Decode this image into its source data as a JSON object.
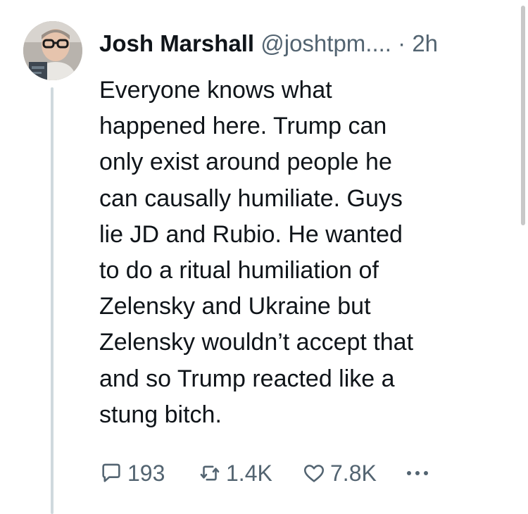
{
  "tweet": {
    "author": {
      "name": "Josh Marshall",
      "handle": "@joshtpm....",
      "separator": "·",
      "time": "2h"
    },
    "text_lines": [
      "Everyone knows what",
      "happened here. Trump can",
      "only exist around people he",
      "can causally humiliate. Guys",
      "lie JD and Rubio. He wanted",
      "to do a ritual humiliation of",
      "Zelensky and Ukraine but",
      "Zelensky wouldn’t accept that",
      "and so Trump reacted like a",
      "stung bitch."
    ],
    "actions": {
      "replies": "193",
      "retweets": "1.4K",
      "likes": "7.8K",
      "more_icon": "more-dots-icon"
    },
    "icons": [
      "reply-icon",
      "retweet-icon",
      "like-icon",
      "more-dots-icon"
    ]
  },
  "colors": {
    "text": "#0f1419",
    "secondary": "#536471",
    "thread_line": "#cfd9de",
    "background": "#ffffff"
  }
}
